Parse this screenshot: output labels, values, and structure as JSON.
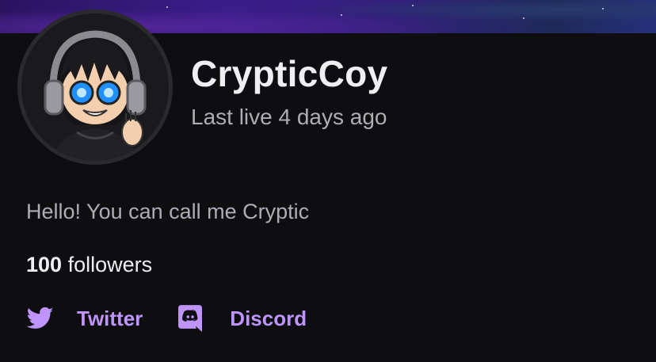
{
  "channel": {
    "display_name": "CrypticCoy",
    "last_live": "Last live 4 days ago",
    "bio": "Hello! You can call me Cryptic",
    "followers_count": "100",
    "followers_label": "followers"
  },
  "social_links": [
    {
      "label": "Twitter",
      "icon": "twitter-bird-icon"
    },
    {
      "label": "Discord",
      "icon": "discord-icon"
    }
  ],
  "colors": {
    "background": "#0e0e10",
    "accent": "#bf94ff",
    "text_primary": "#efeff1",
    "text_secondary": "#adadb8"
  }
}
